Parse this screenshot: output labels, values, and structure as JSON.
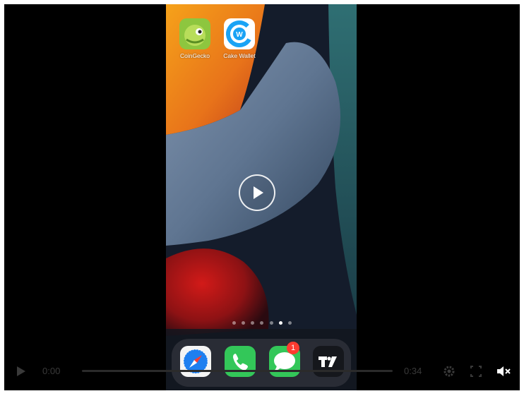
{
  "home_screen": {
    "apps": [
      {
        "label": "CoinGecko",
        "icon": "coingecko-icon"
      },
      {
        "label": "Cake Wallet",
        "icon": "cake-wallet-icon"
      }
    ],
    "page_dots": {
      "count": 7,
      "active_index": 5
    },
    "dock": [
      {
        "icon": "safari-icon"
      },
      {
        "icon": "phone-icon"
      },
      {
        "icon": "messages-icon",
        "badge": "1"
      },
      {
        "icon": "tradingview-icon"
      }
    ]
  },
  "player": {
    "current_time": "0:00",
    "duration": "0:34",
    "progress": 0,
    "icons": [
      "play-icon",
      "settings-gear-icon",
      "fullscreen-icon",
      "mute-icon"
    ]
  },
  "colors": {
    "badge": "#ff3b30",
    "cake_wallet_blue": "#1aa3f5",
    "coingecko_green": "#8dc63f"
  }
}
